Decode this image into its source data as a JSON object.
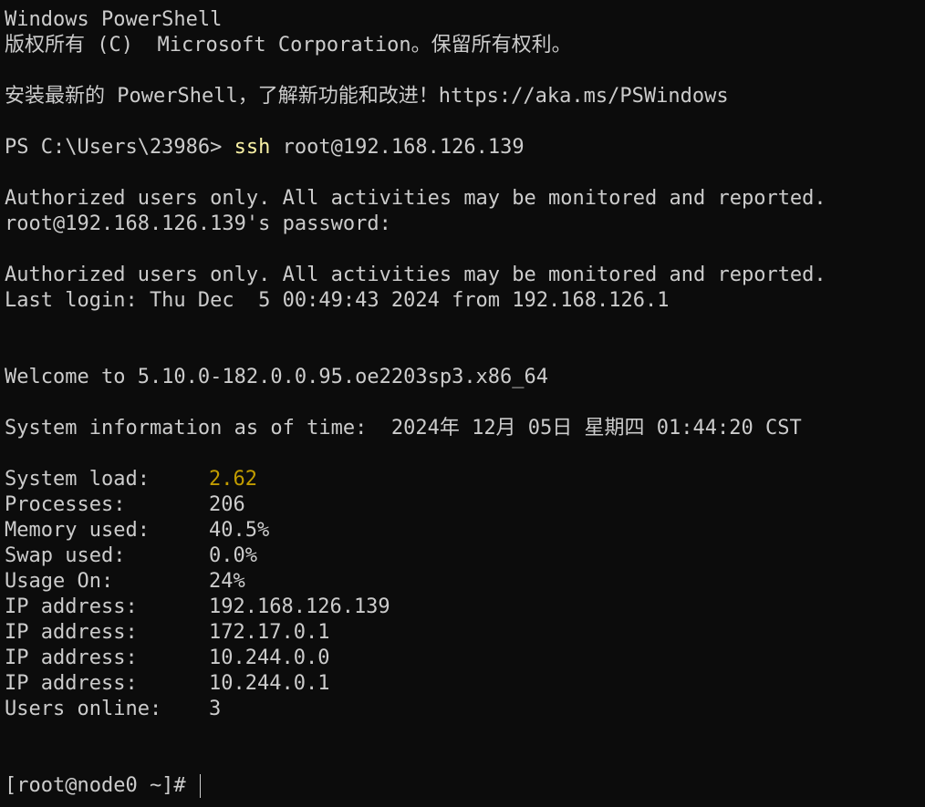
{
  "header": {
    "title_line": "Windows PowerShell",
    "copyright_line": "版权所有 (C)  Microsoft Corporation。保留所有权利。",
    "tip_line": "安装最新的 PowerShell，了解新功能和改进！https://aka.ms/PSWindows"
  },
  "ssh": {
    "prompt": "PS C:\\Users\\23986> ",
    "command": "ssh",
    "args": " root@192.168.126.139",
    "banner1": "Authorized users only. All activities may be monitored and reported.",
    "password_prompt": "root@192.168.126.139's password:",
    "banner2": "Authorized users only. All activities may be monitored and reported.",
    "last_login": "Last login: Thu Dec  5 00:49:43 2024 from 192.168.126.1"
  },
  "motd": {
    "welcome": "Welcome to 5.10.0-182.0.0.95.oe2203sp3.x86_64",
    "sysinfo_line": "System information as of time:  2024年 12月 05日 星期四 01:44:20 CST",
    "stats": [
      {
        "label": "System load:",
        "value": "2.62"
      },
      {
        "label": "Processes:",
        "value": "206"
      },
      {
        "label": "Memory used:",
        "value": "40.5%"
      },
      {
        "label": "Swap used:",
        "value": "0.0%"
      },
      {
        "label": "Usage On:",
        "value": "24%"
      },
      {
        "label": "IP address:",
        "value": "192.168.126.139"
      },
      {
        "label": "IP address:",
        "value": "172.17.0.1"
      },
      {
        "label": "IP address:",
        "value": "10.244.0.0"
      },
      {
        "label": "IP address:",
        "value": "10.244.0.1"
      },
      {
        "label": "Users online:",
        "value": "3"
      }
    ]
  },
  "shell": {
    "prompt": "[root@node0 ~]# "
  },
  "colors": {
    "background": "#0c0c0c",
    "text": "#cccccc",
    "command": "#f9f1a5",
    "highlight": "#c19c00"
  }
}
